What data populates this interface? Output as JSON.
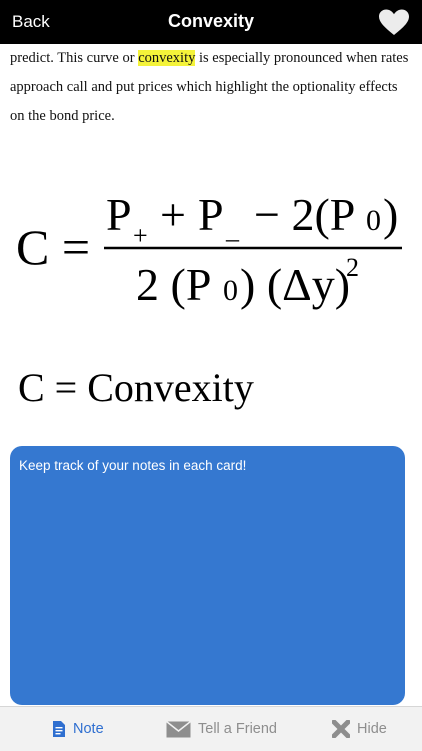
{
  "nav": {
    "back_label": "Back",
    "title": "Convexity",
    "favorite_icon": "heart-icon"
  },
  "content": {
    "paragraph_before": "predict. This curve or ",
    "paragraph_highlight": "convexity",
    "paragraph_after": " is especially pronounced when rates approach call and put prices which highlight the optionality effects on the bond price.",
    "formula": {
      "lhs": "C =",
      "num_p_plus": "P",
      "sub_plus": "+",
      "plus_sign": "+",
      "num_p_minus": "P",
      "sub_minus": "_",
      "minus_two": "− 2(P",
      "sub_zero_num": "0",
      "close_paren_num": ")",
      "den_two": "2 (P",
      "sub_zero_den": "0",
      "den_mid": ") (Δy)",
      "den_exp": "2"
    },
    "definition": "C = Convexity"
  },
  "note": {
    "placeholder": "Keep track of your notes in each card!"
  },
  "tabbar": {
    "tabs": [
      {
        "label": "Note",
        "icon": "document-icon",
        "active": true
      },
      {
        "label": "Tell a Friend",
        "icon": "envelope-icon",
        "active": false
      },
      {
        "label": "Hide",
        "icon": "close-x-icon",
        "active": false
      }
    ]
  },
  "colors": {
    "nav_bg": "#000000",
    "highlight": "#f4f33a",
    "note_bg": "#3578d0",
    "tab_active": "#2f6fd0",
    "tab_inactive": "#8e8e8e"
  }
}
